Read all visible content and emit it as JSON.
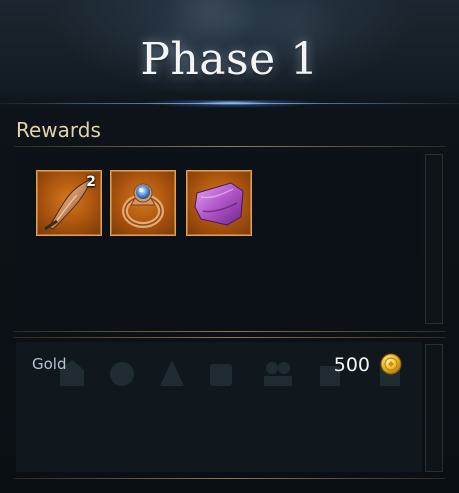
{
  "header": {
    "title": "Phase 1"
  },
  "rewards": {
    "label": "Rewards",
    "items": [
      {
        "icon": "horn-icon",
        "quantity": "2"
      },
      {
        "icon": "ring-icon",
        "quantity": ""
      },
      {
        "icon": "cloth-icon",
        "quantity": ""
      }
    ]
  },
  "gold": {
    "label": "Gold",
    "value": "500",
    "icon": "gold-coin-icon"
  },
  "colors": {
    "slot_border": "#e2a24a",
    "slot_fill": "#d57a1c",
    "section_label": "#e2d2ae",
    "title_glow": "#8cc4ff"
  }
}
